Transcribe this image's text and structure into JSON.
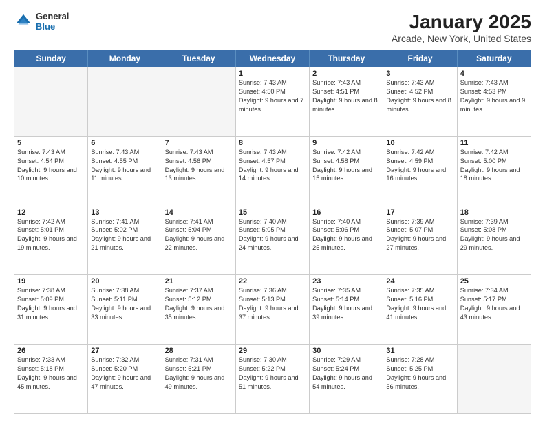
{
  "logo": {
    "general": "General",
    "blue": "Blue"
  },
  "header": {
    "title": "January 2025",
    "subtitle": "Arcade, New York, United States"
  },
  "weekdays": [
    "Sunday",
    "Monday",
    "Tuesday",
    "Wednesday",
    "Thursday",
    "Friday",
    "Saturday"
  ],
  "weeks": [
    [
      {
        "day": "",
        "empty": true
      },
      {
        "day": "",
        "empty": true
      },
      {
        "day": "",
        "empty": true
      },
      {
        "day": "1",
        "sunrise": "7:43 AM",
        "sunset": "4:50 PM",
        "daylight": "9 hours and 7 minutes."
      },
      {
        "day": "2",
        "sunrise": "7:43 AM",
        "sunset": "4:51 PM",
        "daylight": "9 hours and 8 minutes."
      },
      {
        "day": "3",
        "sunrise": "7:43 AM",
        "sunset": "4:52 PM",
        "daylight": "9 hours and 8 minutes."
      },
      {
        "day": "4",
        "sunrise": "7:43 AM",
        "sunset": "4:53 PM",
        "daylight": "9 hours and 9 minutes."
      }
    ],
    [
      {
        "day": "5",
        "sunrise": "7:43 AM",
        "sunset": "4:54 PM",
        "daylight": "9 hours and 10 minutes."
      },
      {
        "day": "6",
        "sunrise": "7:43 AM",
        "sunset": "4:55 PM",
        "daylight": "9 hours and 11 minutes."
      },
      {
        "day": "7",
        "sunrise": "7:43 AM",
        "sunset": "4:56 PM",
        "daylight": "9 hours and 13 minutes."
      },
      {
        "day": "8",
        "sunrise": "7:43 AM",
        "sunset": "4:57 PM",
        "daylight": "9 hours and 14 minutes."
      },
      {
        "day": "9",
        "sunrise": "7:42 AM",
        "sunset": "4:58 PM",
        "daylight": "9 hours and 15 minutes."
      },
      {
        "day": "10",
        "sunrise": "7:42 AM",
        "sunset": "4:59 PM",
        "daylight": "9 hours and 16 minutes."
      },
      {
        "day": "11",
        "sunrise": "7:42 AM",
        "sunset": "5:00 PM",
        "daylight": "9 hours and 18 minutes."
      }
    ],
    [
      {
        "day": "12",
        "sunrise": "7:42 AM",
        "sunset": "5:01 PM",
        "daylight": "9 hours and 19 minutes."
      },
      {
        "day": "13",
        "sunrise": "7:41 AM",
        "sunset": "5:02 PM",
        "daylight": "9 hours and 21 minutes."
      },
      {
        "day": "14",
        "sunrise": "7:41 AM",
        "sunset": "5:04 PM",
        "daylight": "9 hours and 22 minutes."
      },
      {
        "day": "15",
        "sunrise": "7:40 AM",
        "sunset": "5:05 PM",
        "daylight": "9 hours and 24 minutes."
      },
      {
        "day": "16",
        "sunrise": "7:40 AM",
        "sunset": "5:06 PM",
        "daylight": "9 hours and 25 minutes."
      },
      {
        "day": "17",
        "sunrise": "7:39 AM",
        "sunset": "5:07 PM",
        "daylight": "9 hours and 27 minutes."
      },
      {
        "day": "18",
        "sunrise": "7:39 AM",
        "sunset": "5:08 PM",
        "daylight": "9 hours and 29 minutes."
      }
    ],
    [
      {
        "day": "19",
        "sunrise": "7:38 AM",
        "sunset": "5:09 PM",
        "daylight": "9 hours and 31 minutes."
      },
      {
        "day": "20",
        "sunrise": "7:38 AM",
        "sunset": "5:11 PM",
        "daylight": "9 hours and 33 minutes."
      },
      {
        "day": "21",
        "sunrise": "7:37 AM",
        "sunset": "5:12 PM",
        "daylight": "9 hours and 35 minutes."
      },
      {
        "day": "22",
        "sunrise": "7:36 AM",
        "sunset": "5:13 PM",
        "daylight": "9 hours and 37 minutes."
      },
      {
        "day": "23",
        "sunrise": "7:35 AM",
        "sunset": "5:14 PM",
        "daylight": "9 hours and 39 minutes."
      },
      {
        "day": "24",
        "sunrise": "7:35 AM",
        "sunset": "5:16 PM",
        "daylight": "9 hours and 41 minutes."
      },
      {
        "day": "25",
        "sunrise": "7:34 AM",
        "sunset": "5:17 PM",
        "daylight": "9 hours and 43 minutes."
      }
    ],
    [
      {
        "day": "26",
        "sunrise": "7:33 AM",
        "sunset": "5:18 PM",
        "daylight": "9 hours and 45 minutes."
      },
      {
        "day": "27",
        "sunrise": "7:32 AM",
        "sunset": "5:20 PM",
        "daylight": "9 hours and 47 minutes."
      },
      {
        "day": "28",
        "sunrise": "7:31 AM",
        "sunset": "5:21 PM",
        "daylight": "9 hours and 49 minutes."
      },
      {
        "day": "29",
        "sunrise": "7:30 AM",
        "sunset": "5:22 PM",
        "daylight": "9 hours and 51 minutes."
      },
      {
        "day": "30",
        "sunrise": "7:29 AM",
        "sunset": "5:24 PM",
        "daylight": "9 hours and 54 minutes."
      },
      {
        "day": "31",
        "sunrise": "7:28 AM",
        "sunset": "5:25 PM",
        "daylight": "9 hours and 56 minutes."
      },
      {
        "day": "",
        "empty": true
      }
    ]
  ]
}
